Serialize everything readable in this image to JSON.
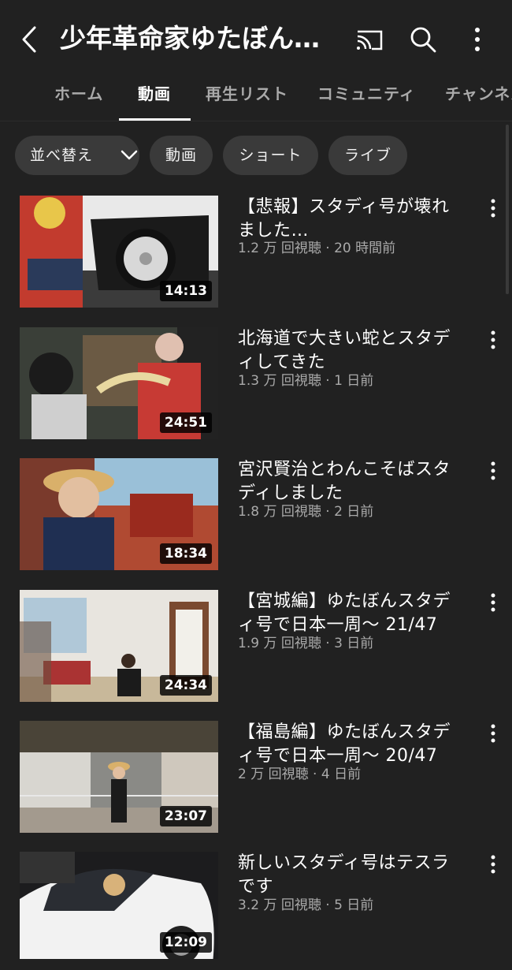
{
  "header": {
    "title": "少年革命家ゆたぼん…",
    "back_icon": "back-arrow-icon",
    "cast_icon": "cast-icon",
    "search_icon": "search-icon",
    "more_icon": "more-vert-icon"
  },
  "tabs": [
    {
      "label": "ホーム",
      "active": false
    },
    {
      "label": "動画",
      "active": true
    },
    {
      "label": "再生リスト",
      "active": false
    },
    {
      "label": "コミュニティ",
      "active": false
    },
    {
      "label": "チャンネル",
      "active": false
    }
  ],
  "chips": {
    "sort": "並べ替え",
    "videos": "動画",
    "shorts": "ショート",
    "live": "ライブ"
  },
  "videos": [
    {
      "title": "【悲報】スタディ号が壊れました…",
      "views": "1.2 万 回視聴",
      "age": "20 時間前",
      "duration": "14:13"
    },
    {
      "title": "北海道で大きい蛇とスタディしてきた",
      "views": "1.3 万 回視聴",
      "age": "1 日前",
      "duration": "24:51"
    },
    {
      "title": "宮沢賢治とわんこそばスタディしました",
      "views": "1.8 万 回視聴",
      "age": "2 日前",
      "duration": "18:34"
    },
    {
      "title": "【宮城編】ゆたぼんスタディ号で日本一周〜 21/47",
      "views": "1.9 万 回視聴",
      "age": "3 日前",
      "duration": "24:34"
    },
    {
      "title": "【福島編】ゆたぼんスタディ号で日本一周〜 20/47",
      "views": "2 万 回視聴",
      "age": "4 日前",
      "duration": "23:07"
    },
    {
      "title": "新しいスタディ号はテスラです",
      "views": "3.2 万 回視聴",
      "age": "5 日前",
      "duration": "12:09"
    }
  ],
  "meta_separator": " · "
}
